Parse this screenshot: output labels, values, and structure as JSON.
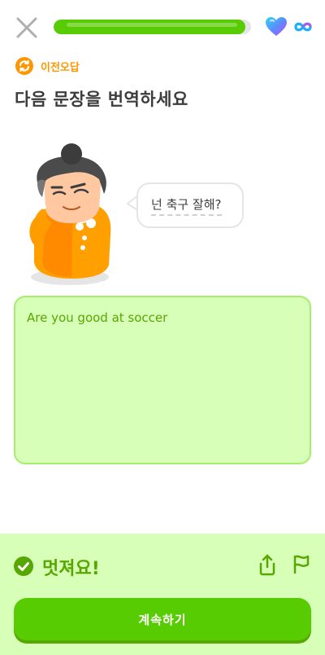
{
  "header": {
    "progress": 0.97,
    "close_icon": "close-icon",
    "heart_icon": "heart-icon",
    "infinity_icon": "infinity-icon",
    "colors": {
      "progress_fill": "#58cc02",
      "progress_track": "#e5e5e5"
    }
  },
  "mistake_tag": {
    "label": "이전오답",
    "icon": "refresh-icon",
    "color": "#ff9600"
  },
  "prompt": {
    "text": "다음 문장을 번역하세요"
  },
  "speech_bubble": {
    "text": "넌 축구 잘해?"
  },
  "answer": {
    "text": "Are you good at soccer"
  },
  "feedback": {
    "title": "멋져요!",
    "check_icon": "check-circle-icon",
    "share_icon": "share-icon",
    "flag_icon": "flag-icon",
    "continue_label": "계속하기",
    "colors": {
      "background": "#d7ffb8",
      "accent": "#58a700",
      "button": "#58cc02"
    }
  }
}
